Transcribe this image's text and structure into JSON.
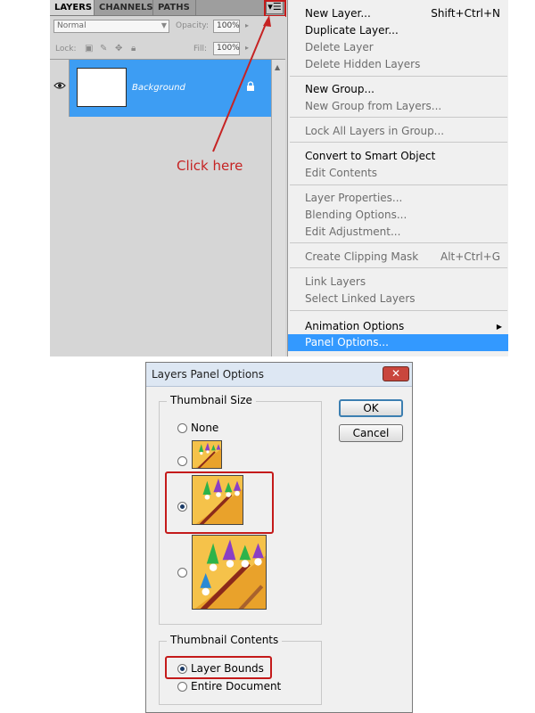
{
  "layers_panel": {
    "tabs": [
      "LAYERS",
      "CHANNELS",
      "PATHS"
    ],
    "blend_mode": "Normal",
    "opacity_label": "Opacity:",
    "opacity_value": "100%",
    "lock_label": "Lock:",
    "fill_label": "Fill:",
    "fill_value": "100%",
    "layer_name": "Background"
  },
  "annotation": {
    "text": "Click here",
    "color": "#c62323"
  },
  "flyout_menu": {
    "items": [
      {
        "label": "New Layer...",
        "shortcut": "Shift+Ctrl+N",
        "enabled": true
      },
      {
        "label": "Duplicate Layer...",
        "shortcut": "",
        "enabled": true
      },
      {
        "label": "Delete Layer",
        "shortcut": "",
        "enabled": false
      },
      {
        "label": "Delete Hidden Layers",
        "shortcut": "",
        "enabled": false
      },
      {
        "label": "New Group...",
        "shortcut": "",
        "enabled": true
      },
      {
        "label": "New Group from Layers...",
        "shortcut": "",
        "enabled": false
      },
      {
        "label": "Lock All Layers in Group...",
        "shortcut": "",
        "enabled": false
      },
      {
        "label": "Convert to Smart Object",
        "shortcut": "",
        "enabled": true
      },
      {
        "label": "Edit Contents",
        "shortcut": "",
        "enabled": false
      },
      {
        "label": "Layer Properties...",
        "shortcut": "",
        "enabled": false
      },
      {
        "label": "Blending Options...",
        "shortcut": "",
        "enabled": false
      },
      {
        "label": "Edit Adjustment...",
        "shortcut": "",
        "enabled": false
      },
      {
        "label": "Create Clipping Mask",
        "shortcut": "Alt+Ctrl+G",
        "enabled": false
      },
      {
        "label": "Link Layers",
        "shortcut": "",
        "enabled": false
      },
      {
        "label": "Select Linked Layers",
        "shortcut": "",
        "enabled": false
      },
      {
        "label": "Animation Options",
        "shortcut": "",
        "enabled": true
      },
      {
        "label": "Panel Options...",
        "shortcut": "",
        "enabled": true,
        "highlighted": true
      }
    ],
    "highlight_color": "#3399ff"
  },
  "dialog": {
    "title": "Layers Panel Options",
    "close_label": "✕",
    "ok_label": "OK",
    "cancel_label": "Cancel",
    "thumbnail_size_label": "Thumbnail Size",
    "thumbnail_size_options": [
      "None",
      "Small",
      "Medium",
      "Large"
    ],
    "thumbnail_size_selected": "Medium",
    "none_label": "None",
    "thumbnail_contents_label": "Thumbnail Contents",
    "layer_bounds_label": "Layer Bounds",
    "entire_document_label": "Entire Document",
    "thumbnail_contents_selected": "Layer Bounds",
    "highlight_color": "#c41a1a"
  }
}
